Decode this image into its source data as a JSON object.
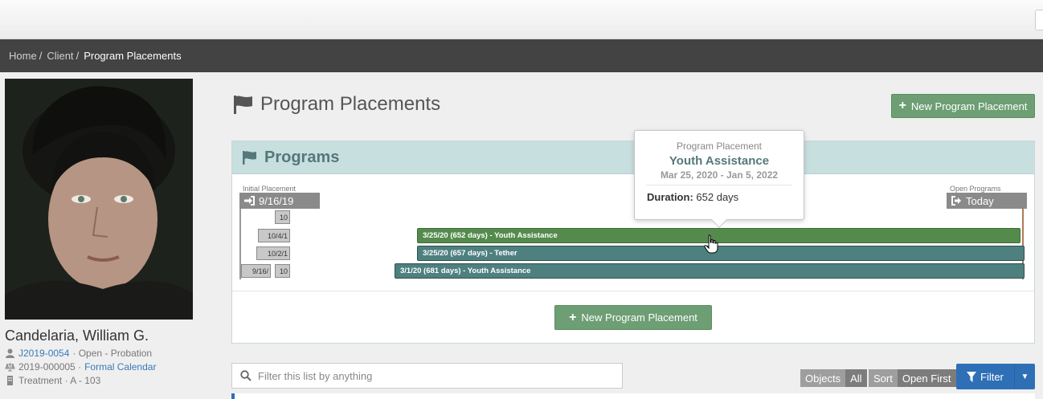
{
  "breadcrumb": {
    "home": "Home",
    "client": "Client",
    "current": "Program Placements"
  },
  "client": {
    "name": "Candelaria, William G.",
    "case_number": "J2019-0054",
    "case_status": "· Open - Probation",
    "court_number": "2019-000005 ·",
    "court_calendar": "Formal Calendar",
    "location": "Treatment · A - 103"
  },
  "page": {
    "title": "Program Placements",
    "new_button": "New Program Placement"
  },
  "programs_panel": {
    "title": "Programs",
    "initial_label": "Initial Placement",
    "start_date": "9/16/19",
    "open_label": "Open Programs",
    "today": "Today",
    "mini_labels": [
      "10",
      "10/4/1",
      "10/2/1",
      "9/16/",
      "10"
    ],
    "bars": [
      {
        "label": "3/25/20 (652 days) - Youth Assistance",
        "color": "green"
      },
      {
        "label": "3/25/20 (657 days) - Tether",
        "color": "teal"
      },
      {
        "label": "3/1/20 (681 days) - Youth Assistance",
        "color": "teal"
      }
    ],
    "new_button": "New Program Placement"
  },
  "tooltip": {
    "heading": "Program Placement",
    "name": "Youth Assistance",
    "dates": "Mar 25, 2020 - Jan 5, 2022",
    "duration_label": "Duration:",
    "duration_value": "652 days"
  },
  "list_controls": {
    "filter_placeholder": "Filter this list by anything",
    "objects": "Objects",
    "all": "All",
    "sort": "Sort",
    "open_first": "Open First",
    "filter": "Filter"
  },
  "colors": {
    "accent_green": "#6d9e74",
    "panel_header": "#c8dfdf",
    "primary_blue": "#2f6fb6",
    "breadcrumb_bg": "#434343"
  }
}
